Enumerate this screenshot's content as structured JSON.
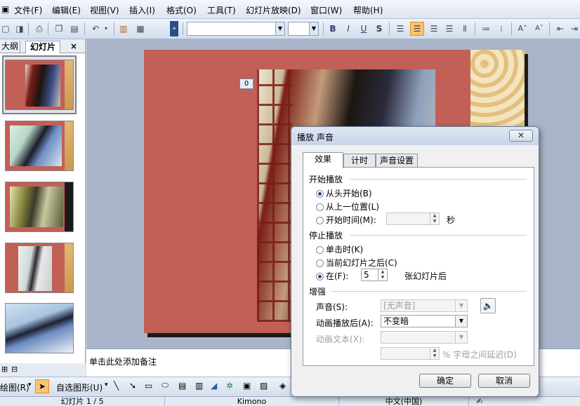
{
  "menu": {
    "file": "文件(F)",
    "edit": "编辑(E)",
    "view": "视图(V)",
    "insert": "插入(I)",
    "format": "格式(O)",
    "tools": "工具(T)",
    "slideshow": "幻灯片放映(D)",
    "window": "窗口(W)",
    "help": "帮助(H)"
  },
  "toolbar": {
    "bold": "B",
    "italic": "I",
    "underline": "U",
    "shadow": "S",
    "increase_font": "A˄",
    "decrease_font": "A˅"
  },
  "left_pane": {
    "tab_outline": "大纲",
    "tab_slides": "幻灯片",
    "close": "×",
    "thumbnail_count": 5
  },
  "slide": {
    "badge": "0"
  },
  "notes": {
    "placeholder": "单击此处添加备注"
  },
  "drawbar": {
    "draw": "绘图(R)",
    "autoshapes": "自选图形(U)"
  },
  "statusbar": {
    "slide": "幻灯片 1 / 5",
    "design": "Kimono",
    "language": "中文(中国)"
  },
  "dialog": {
    "title": "播放 声音",
    "close": "✕",
    "tabs": [
      "效果",
      "计时",
      "声音设置"
    ],
    "start_group": "开始播放",
    "start_options": [
      "从头开始(B)",
      "从上一位置(L)",
      "开始时间(M):"
    ],
    "start_selected": 0,
    "seconds_unit": "秒",
    "stop_group": "停止播放",
    "stop_options": [
      "单击时(K)",
      "当前幻灯片之后(C)",
      "在(F):"
    ],
    "stop_selected": 2,
    "stop_after_value": "5",
    "stop_after_unit": "张幻灯片后",
    "enhance_group": "增强",
    "sound_label": "声音(S):",
    "sound_value": "[无声音]",
    "after_anim_label": "动画播放后(A):",
    "after_anim_value": "不变暗",
    "anim_text_label": "动画文本(X):",
    "anim_text_value": "",
    "letter_delay_label": "% 字母之间延迟(D)",
    "ok": "确定",
    "cancel": "取消"
  }
}
